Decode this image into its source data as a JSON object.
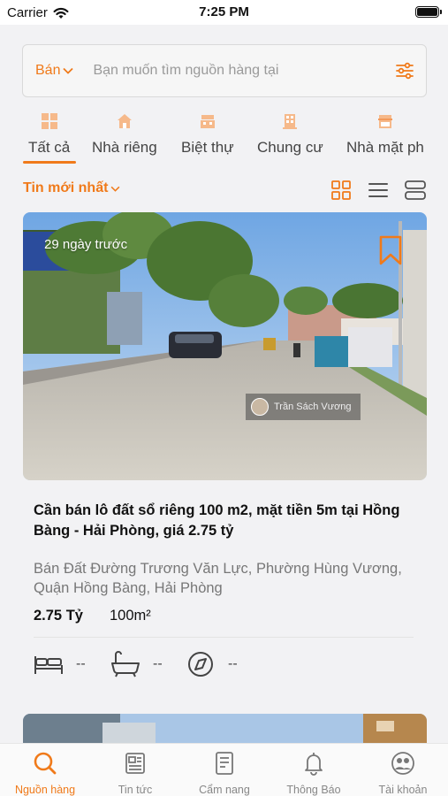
{
  "status_bar": {
    "carrier": "Carrier",
    "time": "7:25 PM"
  },
  "search": {
    "type_label": "Bán",
    "placeholder": "Bạn muốn tìm nguồn hàng tại"
  },
  "categories": [
    {
      "label": "Tất cả",
      "icon": "grid-squares-icon",
      "active": true
    },
    {
      "label": "Nhà riêng",
      "icon": "house-icon",
      "active": false
    },
    {
      "label": "Biệt thự",
      "icon": "villa-icon",
      "active": false
    },
    {
      "label": "Chung cư",
      "icon": "apartment-icon",
      "active": false
    },
    {
      "label": "Nhà mặt ph",
      "icon": "shophouse-icon",
      "active": false
    }
  ],
  "sort": {
    "label": "Tin mới nhất"
  },
  "listing": {
    "time_ago": "29 ngày trước",
    "watermark": "Trần Sách Vương",
    "title": "Cần bán lô đất sổ riêng 100 m2, mặt tiền 5m tại Hồng Bàng - Hải Phòng, giá 2.75 tỷ",
    "address": "Bán Đất Đường Trương Văn Lực, Phường Hùng Vương, Quận Hồng Bàng, Hải Phòng",
    "price": "2.75 Tỷ",
    "area": "100m²",
    "bedrooms": "--",
    "bathrooms": "--",
    "direction": "--"
  },
  "tabs": [
    {
      "label": "Nguồn hàng",
      "icon": "search-icon",
      "active": true
    },
    {
      "label": "Tin tức",
      "icon": "newspaper-icon",
      "active": false
    },
    {
      "label": "Cẩm nang",
      "icon": "handbook-icon",
      "active": false
    },
    {
      "label": "Thông Báo",
      "icon": "bell-icon",
      "active": false
    },
    {
      "label": "Tài khoản",
      "icon": "account-icon",
      "active": false
    }
  ],
  "colors": {
    "accent": "#f07a1a",
    "background": "#f2f2f4"
  }
}
